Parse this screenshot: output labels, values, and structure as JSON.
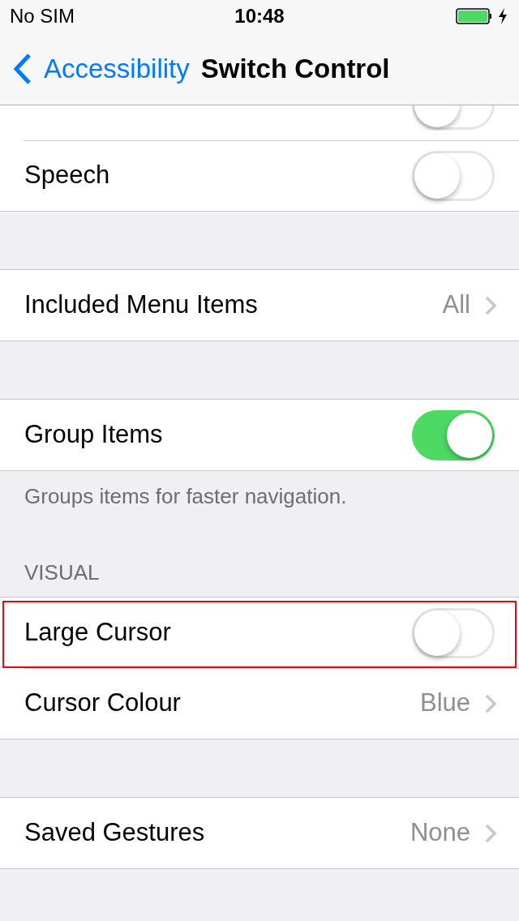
{
  "status_bar": {
    "carrier": "No SIM",
    "time": "10:48"
  },
  "nav": {
    "back": "Accessibility",
    "title": "Switch Control"
  },
  "groups": [
    {
      "rows": [
        {
          "kind": "toggle",
          "on": false,
          "highlighted": false
        },
        {
          "kind": "toggle",
          "label": "Speech",
          "on": false,
          "highlighted": false
        }
      ]
    },
    {
      "rows": [
        {
          "kind": "disclosure",
          "label": "Included Menu Items",
          "value": "All",
          "highlighted": false
        }
      ]
    },
    {
      "rows": [
        {
          "kind": "toggle",
          "label": "Group Items",
          "on": true,
          "highlighted": false
        }
      ],
      "footer": "Groups items for faster navigation."
    },
    {
      "header": "VISUAL",
      "rows": [
        {
          "kind": "toggle",
          "label": "Large Cursor",
          "on": false,
          "highlighted": true
        },
        {
          "kind": "disclosure",
          "label": "Cursor Colour",
          "value": "Blue",
          "highlighted": false
        }
      ]
    },
    {
      "rows": [
        {
          "kind": "disclosure",
          "label": "Saved Gestures",
          "value": "None",
          "highlighted": false
        }
      ]
    }
  ]
}
